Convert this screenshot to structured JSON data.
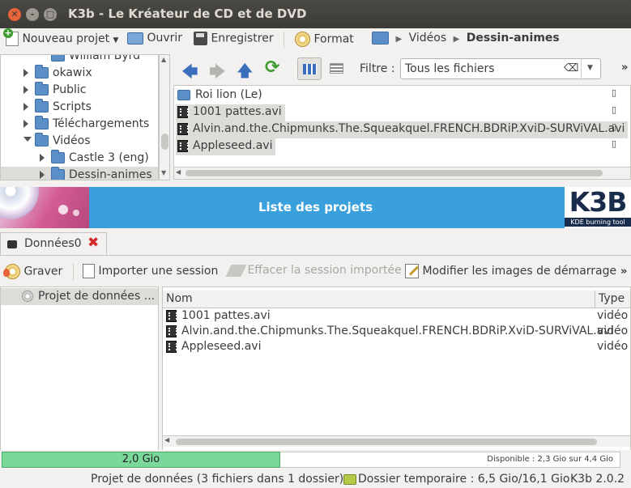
{
  "window": {
    "title": "K3b - Le Kréateur de CD et de DVD"
  },
  "toolbar": {
    "new_project": "Nouveau projet",
    "open": "Ouvrir",
    "save": "Enregistrer",
    "format": "Format",
    "breadcrumb": [
      "Vidéos",
      "Dessin-animes"
    ]
  },
  "folder_tree": {
    "items": [
      {
        "label": "William Byrd",
        "indent": 2,
        "expander": "none"
      },
      {
        "label": "okawix",
        "indent": 1,
        "expander": "collapsed"
      },
      {
        "label": "Public",
        "indent": 1,
        "expander": "collapsed"
      },
      {
        "label": "Scripts",
        "indent": 1,
        "expander": "collapsed"
      },
      {
        "label": "Téléchargements",
        "indent": 1,
        "expander": "collapsed"
      },
      {
        "label": "Vidéos",
        "indent": 1,
        "expander": "expanded"
      },
      {
        "label": "Castle 3 (eng)",
        "indent": 2,
        "expander": "collapsed"
      },
      {
        "label": "Dessin-animes",
        "indent": 2,
        "expander": "collapsed",
        "selected": true
      }
    ]
  },
  "file_browser": {
    "filter_label": "Filtre :",
    "filter_value": "Tous les fichiers",
    "files": [
      {
        "name": "Roi lion (Le)",
        "kind": "folder"
      },
      {
        "name": "1001 pattes.avi",
        "kind": "video"
      },
      {
        "name": "Alvin.and.the.Chipmunks.The.Squeakquel.FRENCH.BDRiP.XviD-SURViVAL.avi",
        "kind": "video"
      },
      {
        "name": "Appleseed.avi",
        "kind": "video"
      }
    ]
  },
  "banner": {
    "title": "Liste des projets",
    "logo": "K3B",
    "logo_sub": "KDE burning tool"
  },
  "project_tab": {
    "label": "Données0"
  },
  "project_toolbar": {
    "burn": "Graver",
    "import_session": "Importer une session",
    "clear_session": "Effacer la session importée",
    "edit_boot": "Modifier les images de démarrage"
  },
  "project": {
    "root_label": "Projet de données ...",
    "columns": [
      "Nom",
      "Type"
    ],
    "files": [
      {
        "name": "1001 pattes.avi",
        "type": "vidéo A"
      },
      {
        "name": "Alvin.and.the.Chipmunks.The.Squeakquel.FRENCH.BDRiP.XviD-SURViVAL.avi",
        "type": "vidéo A"
      },
      {
        "name": "Appleseed.avi",
        "type": "vidéo A"
      }
    ]
  },
  "capacity": {
    "used_label": "2,0 Gio",
    "available_label": "Disponible : 2,3 Gio sur 4,4 Gio",
    "used_fraction": 0.45
  },
  "status_bar": {
    "project_info": "Projet de données (3 fichiers dans 1 dossier)",
    "temp_dir": "Dossier temporaire : 6,5 Gio/16,1 Gio",
    "version": "K3b 2.0.2"
  },
  "colors": {
    "accent": "#3aa0dc",
    "capacity_fill": "#7ad99a",
    "close_button": "#e8643a"
  }
}
